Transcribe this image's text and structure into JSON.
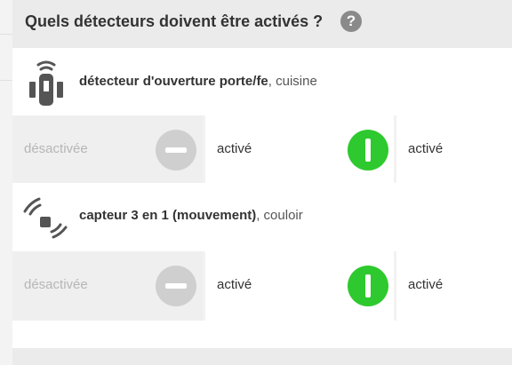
{
  "header": {
    "title": "Quels détecteurs doivent être activés ?",
    "help_glyph": "?"
  },
  "devices": [
    {
      "icon": "door-window-sensor-icon",
      "name": "détecteur d'ouverture porte/fe",
      "room": ", cuisine",
      "states": [
        {
          "label": "désactivée",
          "active": false
        },
        {
          "label": "activé",
          "active": true
        },
        {
          "label": "activé",
          "active": true
        }
      ]
    },
    {
      "icon": "motion-sensor-icon",
      "name": "capteur 3 en 1 (mouvement)",
      "room": ", couloir",
      "states": [
        {
          "label": "désactivée",
          "active": false
        },
        {
          "label": "activé",
          "active": true
        },
        {
          "label": "activé",
          "active": true
        }
      ]
    }
  ],
  "colors": {
    "active": "#2ec92e",
    "inactive": "#cfcfcf",
    "header_bg": "#ebebeb"
  }
}
